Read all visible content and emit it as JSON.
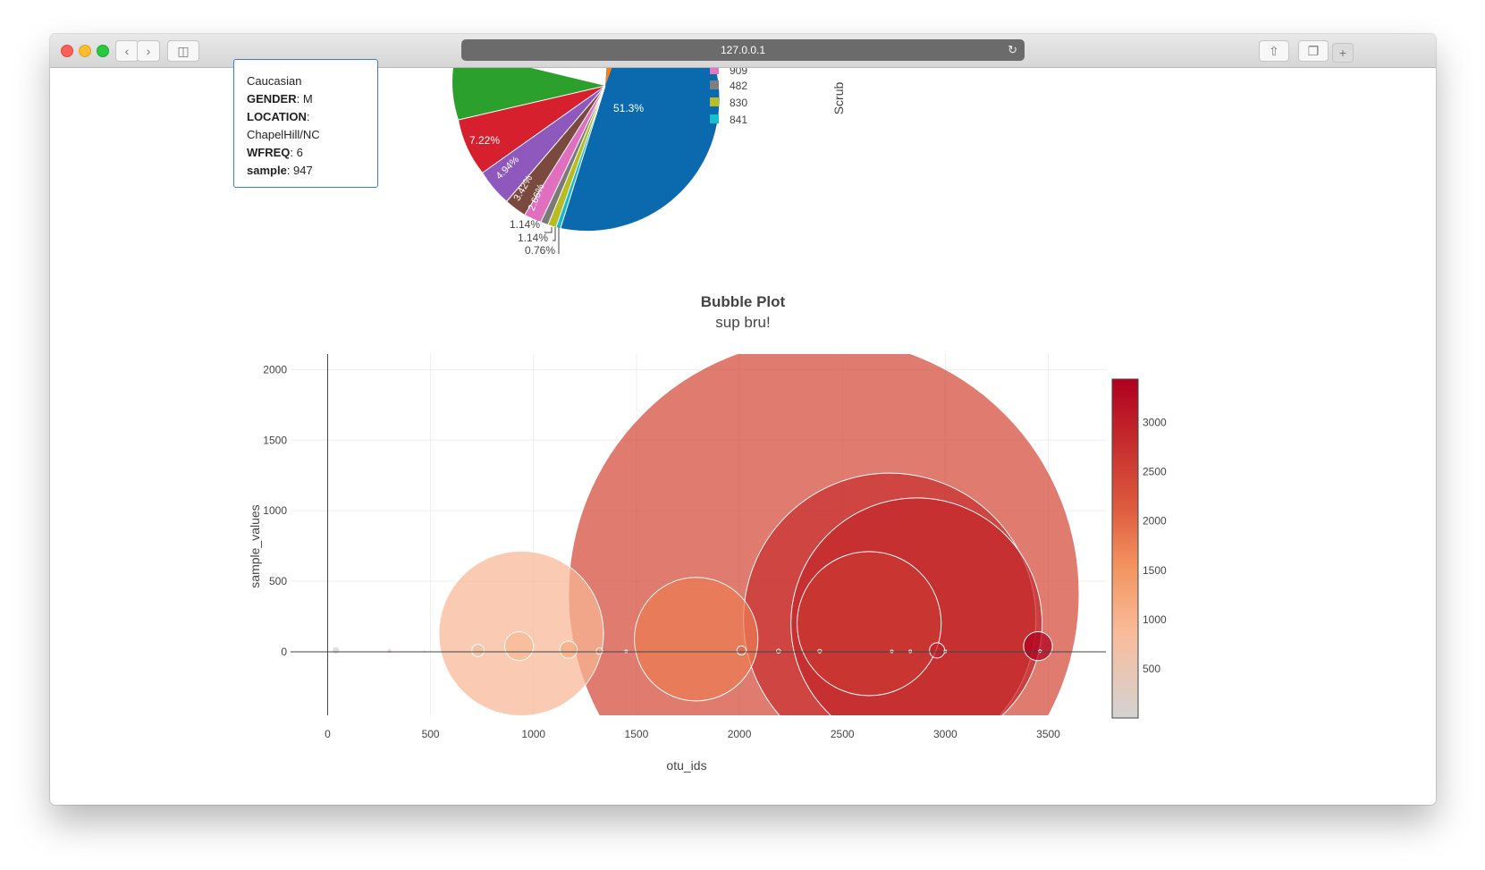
{
  "browser": {
    "url": "127.0.0.1",
    "reload_icon": "reload-icon",
    "back_icon": "chevron-left-icon",
    "forward_icon": "chevron-right-icon",
    "sidebar_icon": "sidebar-icon",
    "share_icon": "share-icon",
    "tabs_icon": "tabs-icon",
    "new_tab_label": "+"
  },
  "metadata": {
    "ethnicity_value": "Caucasian",
    "gender_label": "GENDER",
    "gender_value": ": M",
    "location_label": "LOCATION",
    "location_colon": ":",
    "location_value": "ChapelHill/NC",
    "wfreq_label": "WFREQ",
    "wfreq_value": ": 6",
    "sample_label": "sample",
    "sample_value": ": 947"
  },
  "pie": {
    "slices": [
      {
        "label": "51.3%",
        "color": "#0a6aad"
      },
      {
        "label": "7.22%",
        "color": "#d6202e"
      },
      {
        "label": "4.94%",
        "color": "#8f58bd"
      },
      {
        "label": "3.42%",
        "color": "#7b4a3f"
      },
      {
        "label": "2.66%",
        "color": "#e06fc0"
      },
      {
        "label": "1.14%",
        "color": "#7a7a7a"
      },
      {
        "label": "1.14%",
        "color": "#b8bb22"
      },
      {
        "label": "0.76%",
        "color": "#19b8ce"
      }
    ],
    "other_colors": {
      "green": "#2ca02c",
      "orange": "#ff7f0e"
    },
    "legend": [
      {
        "label": "909",
        "color": "#e377c2"
      },
      {
        "label": "482",
        "color": "#7f7f7f"
      },
      {
        "label": "830",
        "color": "#bcbd22"
      },
      {
        "label": "841",
        "color": "#17becf"
      }
    ],
    "side_label": "Scrub"
  },
  "chart_data": {
    "type": "scatter",
    "title": "Bubble Plot",
    "subtitle": "sup bru!",
    "xlabel": "otu_ids",
    "ylabel": "sample_values",
    "xlim": [
      -180,
      3780
    ],
    "ylim": [
      -450,
      2110
    ],
    "xticks": [
      0,
      500,
      1000,
      1500,
      2000,
      2500,
      3000,
      3500
    ],
    "yticks": [
      0,
      500,
      1000,
      1500,
      2000
    ],
    "colorbar": {
      "ticks": [
        500,
        1000,
        1500,
        2000,
        2500,
        3000
      ],
      "range": [
        1,
        3440
      ],
      "colors": [
        "#d3d3d3",
        "#f9bc9b",
        "#f3935f",
        "#dd5b3f",
        "#c42b2c",
        "#b0001f"
      ]
    },
    "points": [
      {
        "x": 2410,
        "y": 410,
        "r": 1240
      },
      {
        "x": 2730,
        "y": 230,
        "r": 710
      },
      {
        "x": 2860,
        "y": 200,
        "r": 610
      },
      {
        "x": 2630,
        "y": 200,
        "r": 350
      },
      {
        "x": 940,
        "y": 130,
        "r": 400
      },
      {
        "x": 1790,
        "y": 90,
        "r": 300
      },
      {
        "x": 3450,
        "y": 40,
        "r": 70
      },
      {
        "x": 930,
        "y": 40,
        "r": 70
      },
      {
        "x": 1170,
        "y": 15,
        "r": 42
      },
      {
        "x": 2960,
        "y": 10,
        "r": 37
      },
      {
        "x": 730,
        "y": 10,
        "r": 30
      },
      {
        "x": 2010,
        "y": 10,
        "r": 22
      },
      {
        "x": 1320,
        "y": 5,
        "r": 16
      },
      {
        "x": 40,
        "y": 10,
        "r": 18
      },
      {
        "x": 2190,
        "y": 5,
        "r": 10
      },
      {
        "x": 2390,
        "y": 5,
        "r": 9
      },
      {
        "x": 300,
        "y": 5,
        "r": 11
      },
      {
        "x": 2830,
        "y": 3,
        "r": 6
      },
      {
        "x": 2740,
        "y": 3,
        "r": 5
      },
      {
        "x": 3000,
        "y": 3,
        "r": 5
      },
      {
        "x": 3460,
        "y": 5,
        "r": 6
      },
      {
        "x": 1450,
        "y": 3,
        "r": 6
      },
      {
        "x": 470,
        "y": 3,
        "r": 5
      }
    ]
  }
}
